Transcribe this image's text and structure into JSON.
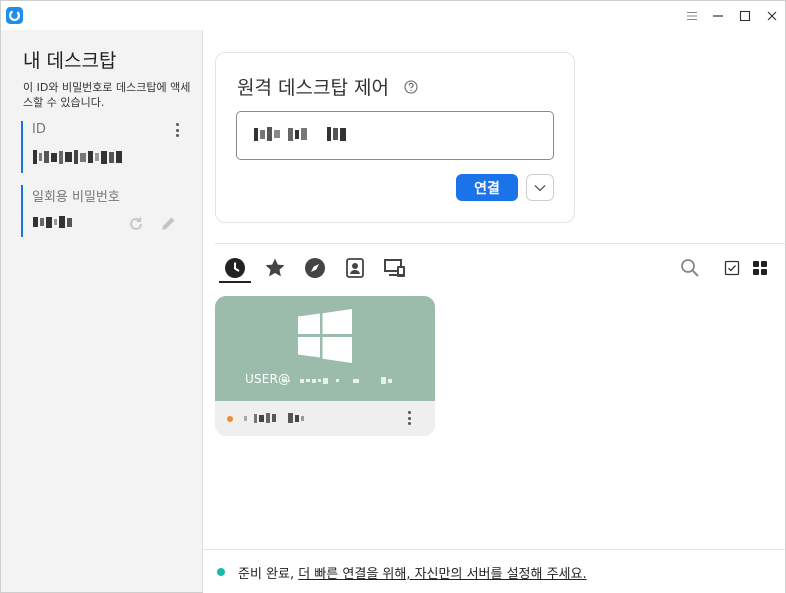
{
  "titlebar": {
    "icons": [
      "app-logo-icon",
      "menu-icon",
      "minimize-icon",
      "maximize-icon",
      "close-icon"
    ]
  },
  "sidebar": {
    "title": "내 데스크탑",
    "description": "이 ID와 비밀번호로 데스크탑에 액세스할 수 있습니다.",
    "id_label": "ID",
    "id_value_redacted": true,
    "otp_label": "일회용 비밀번호",
    "otp_value_redacted": true
  },
  "control": {
    "title": "원격 데스크탑 제어",
    "connect_label": "연결",
    "input_value_redacted": true
  },
  "tabs": [
    "recent-tab",
    "favorites-tab",
    "discover-tab",
    "address-book-tab",
    "devices-tab"
  ],
  "device": {
    "user_prefix": "USER@",
    "os": "windows",
    "status_color": "#f08a2a"
  },
  "status": {
    "prefix": "준비 완료, ",
    "link": "더 빠른 연결을 위해, 자신만의 서버를 설정해 주세요."
  },
  "colors": {
    "accent": "#1a73e8",
    "ready": "#1cb8a8",
    "thumb_bg": "#9bbcab"
  }
}
